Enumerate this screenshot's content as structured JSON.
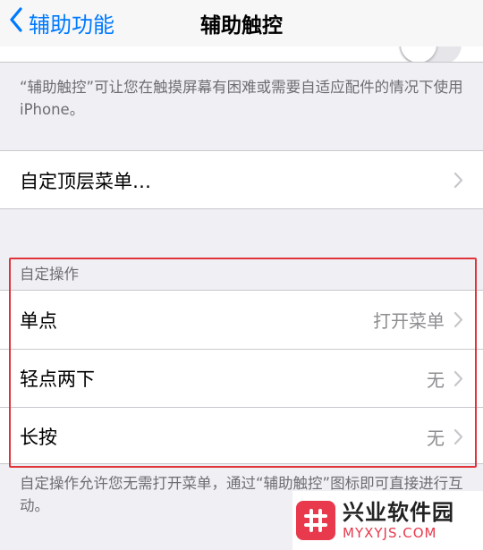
{
  "navbar": {
    "back_label": "辅助功能",
    "title": "辅助触控"
  },
  "notes": {
    "top": "“辅助触控”可让您在触摸屏幕有困难或需要自适应配件的情况下使用 iPhone。",
    "bottom": "自定操作允许您无需打开菜单，通过“辅助触控”图标即可直接进行互动。"
  },
  "menu_row": {
    "label": "自定顶层菜单…"
  },
  "custom_actions": {
    "header": "自定操作",
    "items": [
      {
        "label": "单点",
        "value": "打开菜单"
      },
      {
        "label": "轻点两下",
        "value": "无"
      },
      {
        "label": "长按",
        "value": "无"
      }
    ]
  },
  "watermark": {
    "name": "兴业软件园",
    "url": "MYXYJS.COM"
  },
  "colors": {
    "accent": "#007aff",
    "highlight": "#e0343b",
    "brand": "#e8394d"
  },
  "icons": {
    "back": "chevron-left-icon",
    "disclosure": "chevron-right-icon",
    "logo": "hash-logo-icon"
  }
}
